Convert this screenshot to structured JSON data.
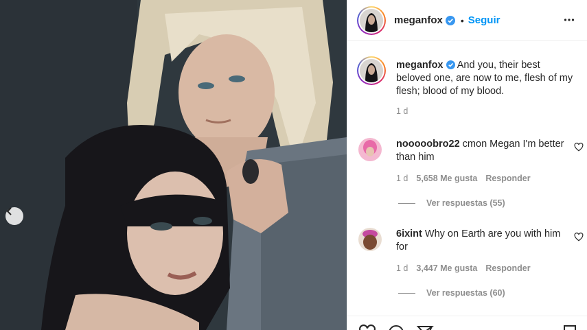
{
  "post": {
    "username": "meganfox",
    "follow_label": "Seguir",
    "separator": "•",
    "caption": "And you, their best beloved one, are now to me, flesh of my flesh; blood of my blood.",
    "time": "1 d"
  },
  "comments": [
    {
      "username": "nooooobro22",
      "text": "cmon Megan I'm better than him",
      "time": "1 d",
      "likes": "5,658 Me gusta",
      "reply_label": "Responder",
      "view_replies": "Ver respuestas (55)"
    },
    {
      "username": "6ixint",
      "text": "Why on Earth are you with him for",
      "time": "1 d",
      "likes": "3,447 Me gusta",
      "reply_label": "Responder",
      "view_replies": "Ver respuestas (60)"
    }
  ],
  "colors": {
    "accent": "#0095f6",
    "text": "#262626",
    "muted": "#8e8e8e",
    "verified": "#3897f0"
  },
  "icons": [
    "chevron-left-icon",
    "verified-badge-icon",
    "more-options-icon",
    "heart-icon",
    "like-icon",
    "comment-icon",
    "share-icon",
    "save-icon"
  ]
}
